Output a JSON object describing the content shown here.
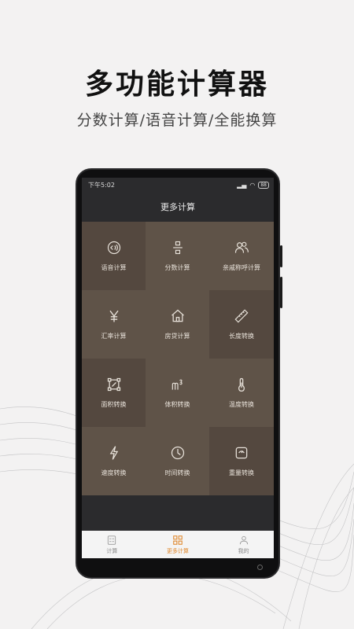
{
  "promo": {
    "headline": "多功能计算器",
    "subline": "分数计算/语音计算/全能换算"
  },
  "status": {
    "time": "下午5:02",
    "battery": "88"
  },
  "screen": {
    "title": "更多计算"
  },
  "grid": {
    "items": [
      {
        "label": "语音计算",
        "icon": "voice-icon"
      },
      {
        "label": "分数计算",
        "icon": "fraction-icon"
      },
      {
        "label": "亲戚称呼计算",
        "icon": "relatives-icon"
      },
      {
        "label": "汇率计算",
        "icon": "yen-icon"
      },
      {
        "label": "房贷计算",
        "icon": "house-icon"
      },
      {
        "label": "长度转换",
        "icon": "ruler-icon"
      },
      {
        "label": "面积转换",
        "icon": "area-icon"
      },
      {
        "label": "体积转换",
        "icon": "volume-icon"
      },
      {
        "label": "温度转换",
        "icon": "thermometer-icon"
      },
      {
        "label": "速度转换",
        "icon": "lightning-icon"
      },
      {
        "label": "时间转换",
        "icon": "clock-icon"
      },
      {
        "label": "重量转换",
        "icon": "scale-icon"
      }
    ]
  },
  "tabs": [
    {
      "label": "计算",
      "icon": "calculator-icon"
    },
    {
      "label": "更多计算",
      "icon": "grid-icon"
    },
    {
      "label": "我的",
      "icon": "user-icon"
    }
  ],
  "colors": {
    "accent": "#e0872b",
    "cell_dark": "#54483f",
    "cell_light": "#5f5348"
  }
}
